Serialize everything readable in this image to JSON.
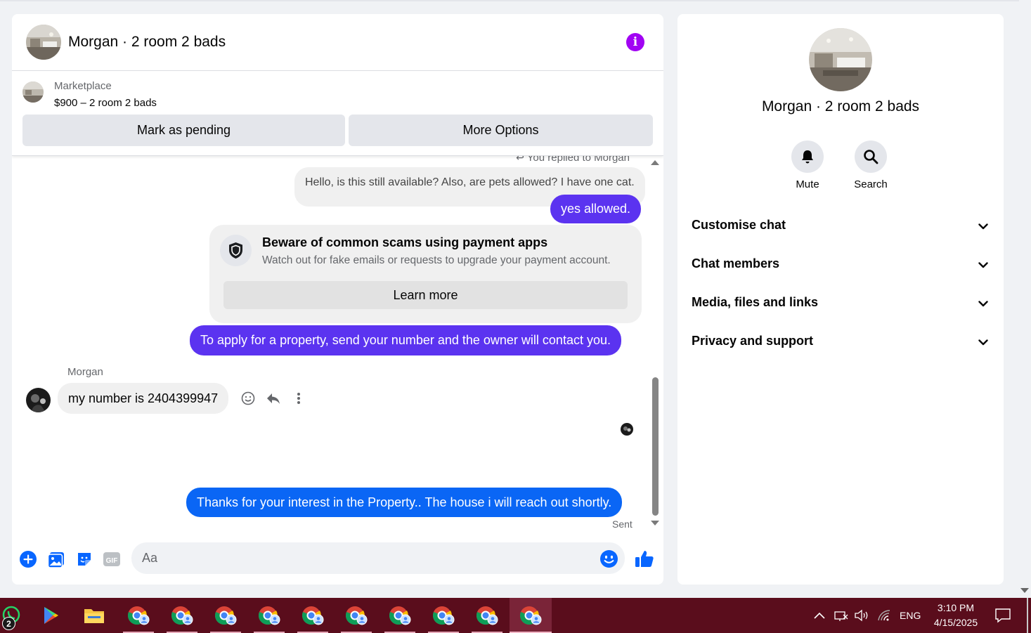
{
  "chat": {
    "title": "Morgan · 2 room 2 bads",
    "listing": {
      "source": "Marketplace",
      "price_title": "$900 – 2 room 2 bads",
      "mark_pending_label": "Mark as pending",
      "more_options_label": "More Options"
    },
    "replied_note": "You replied to Morgan",
    "messages": {
      "quoted": "Hello, is this still available? Also, are pets allowed? I have one cat.",
      "reply_allowed": "yes allowed.",
      "apply_info": "To apply for a property, send your number and the owner will contact you.",
      "sender_name": "Morgan",
      "incoming_number": "my number is 2404399947",
      "thanks": "Thanks for your interest in the Property.. The house i will reach  out shortly.",
      "status": "Sent"
    },
    "scam_card": {
      "title": "Beware of common scams using payment apps",
      "text": "Watch out for fake emails or requests to upgrade your payment account.",
      "button": "Learn more"
    },
    "composer": {
      "placeholder": "Aa",
      "icons": [
        "plus-circle-icon",
        "photo-icon",
        "sticker-icon",
        "gif-icon",
        "emoji-icon",
        "thumbs-up-icon"
      ]
    }
  },
  "info_panel": {
    "name": "Morgan · 2 room 2 bads",
    "actions": [
      {
        "label": "Mute",
        "icon": "bell-icon"
      },
      {
        "label": "Search",
        "icon": "search-icon"
      }
    ],
    "sections": [
      {
        "label": "Customise chat"
      },
      {
        "label": "Chat members"
      },
      {
        "label": "Media, files and links"
      },
      {
        "label": "Privacy and support"
      }
    ]
  },
  "taskbar": {
    "whatsapp_badge": "2",
    "language": "ENG",
    "time": "3:10 PM",
    "date": "4/15/2025"
  },
  "colors": {
    "purple_bubble": "#5b33f0",
    "blue_bubble": "#0a66f5",
    "info_accent": "#a103f3",
    "messenger_blue": "#0866ff",
    "taskbar": "#5a0d1c"
  }
}
